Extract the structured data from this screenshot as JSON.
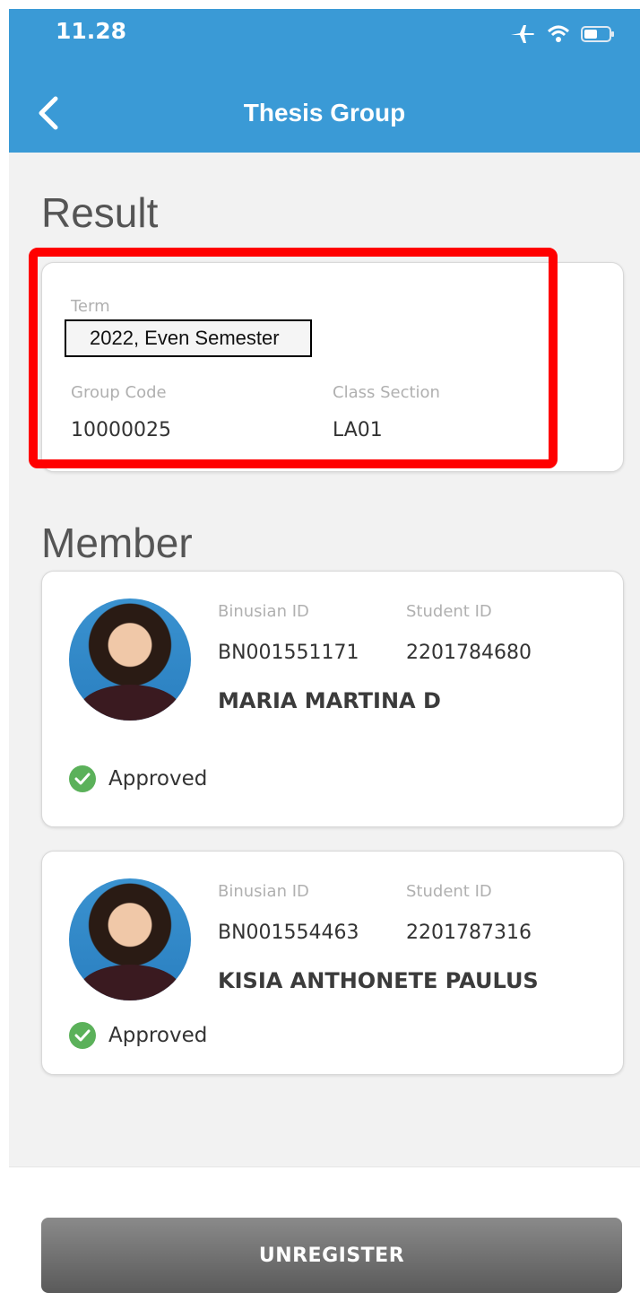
{
  "status_bar": {
    "time": "11.28"
  },
  "header": {
    "title": "Thesis Group"
  },
  "result": {
    "section_title": "Result",
    "term_label": "Term",
    "term_value": "2022, Even Semester",
    "group_code_label": "Group Code",
    "group_code_value": "10000025",
    "class_section_label": "Class Section",
    "class_section_value": "LA01"
  },
  "member": {
    "section_title": "Member",
    "items": [
      {
        "binusian_id_label": "Binusian ID",
        "binusian_id": "BN001551171",
        "student_id_label": "Student ID",
        "student_id": "2201784680",
        "name": "MARIA MARTINA D",
        "status": "Approved"
      },
      {
        "binusian_id_label": "Binusian ID",
        "binusian_id": "BN001554463",
        "student_id_label": "Student ID",
        "student_id": "2201787316",
        "name": "KISIA ANTHONETE PAULUS",
        "status": "Approved"
      }
    ]
  },
  "footer": {
    "unregister_label": "UNREGISTER"
  },
  "colors": {
    "header": "#3a9ad6",
    "approved": "#5bb15a",
    "highlight": "#ff0000"
  },
  "icons": [
    "back-arrow-icon",
    "airplane-icon",
    "wifi-icon",
    "battery-icon",
    "check-icon",
    "avatar"
  ]
}
